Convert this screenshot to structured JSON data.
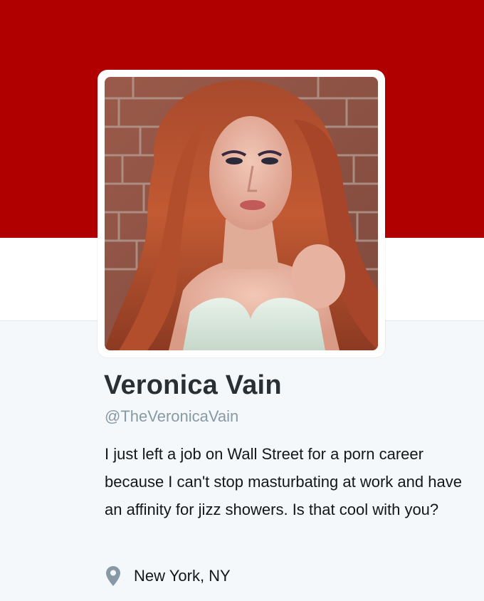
{
  "header": {
    "banner_color": "#b00000"
  },
  "profile": {
    "name": "Veronica Vain",
    "handle": "@TheVeronicaVain",
    "bio": "I just left a job on Wall Street for a porn career because I can't stop masturbating at work and have an affinity for jizz showers. Is that cool with you?",
    "location": "New York, NY",
    "location_icon": "map-pin-icon"
  },
  "colors": {
    "name": "#292f33",
    "handle": "#8899a6",
    "bio": "#14171a",
    "page_background": "#f5f8fa"
  }
}
